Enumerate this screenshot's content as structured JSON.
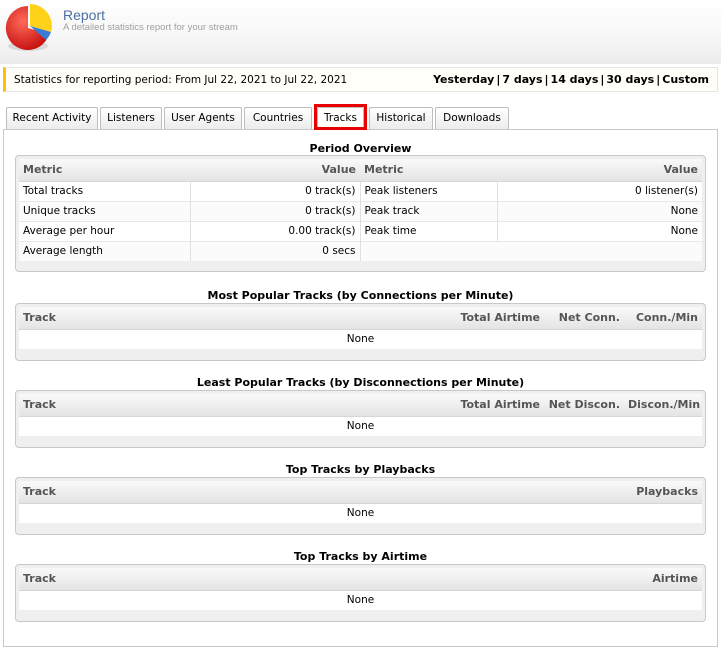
{
  "header": {
    "title": "Report",
    "subtitle": "A detailed statistics report for your stream"
  },
  "period": {
    "text": "Statistics for reporting period: From Jul 22, 2021 to Jul 22, 2021",
    "links": [
      "Yesterday",
      "7 days",
      "14 days",
      "30 days",
      "Custom"
    ]
  },
  "tabs": [
    "Recent Activity",
    "Listeners",
    "User Agents",
    "Countries",
    "Tracks",
    "Historical",
    "Downloads"
  ],
  "active_tab": "Tracks",
  "overview": {
    "title": "Period Overview",
    "headers": [
      "Metric",
      "Value",
      "Metric",
      "Value"
    ],
    "rows": [
      [
        "Total tracks",
        "0 track(s)",
        "Peak listeners",
        "0 listener(s)"
      ],
      [
        "Unique tracks",
        "0 track(s)",
        "Peak track",
        "None"
      ],
      [
        "Average per hour",
        "0.00 track(s)",
        "Peak time",
        "None"
      ],
      [
        "Average length",
        "0 secs",
        "",
        ""
      ]
    ]
  },
  "most_popular": {
    "title": "Most Popular Tracks (by Connections per Minute)",
    "headers": [
      "Track",
      "Total Airtime",
      "Net Conn.",
      "Conn./Min"
    ],
    "empty": "None"
  },
  "least_popular": {
    "title": "Least Popular Tracks (by Disconnections per Minute)",
    "headers": [
      "Track",
      "Total Airtime",
      "Net Discon.",
      "Discon./Min"
    ],
    "empty": "None"
  },
  "top_playbacks": {
    "title": "Top Tracks by Playbacks",
    "headers": [
      "Track",
      "Playbacks"
    ],
    "empty": "None"
  },
  "top_airtime": {
    "title": "Top Tracks by Airtime",
    "headers": [
      "Track",
      "Airtime"
    ],
    "empty": "None"
  },
  "colors": {
    "accent_border": "#ffc000",
    "highlight": "#e80000",
    "title": "#4a6fa0"
  }
}
